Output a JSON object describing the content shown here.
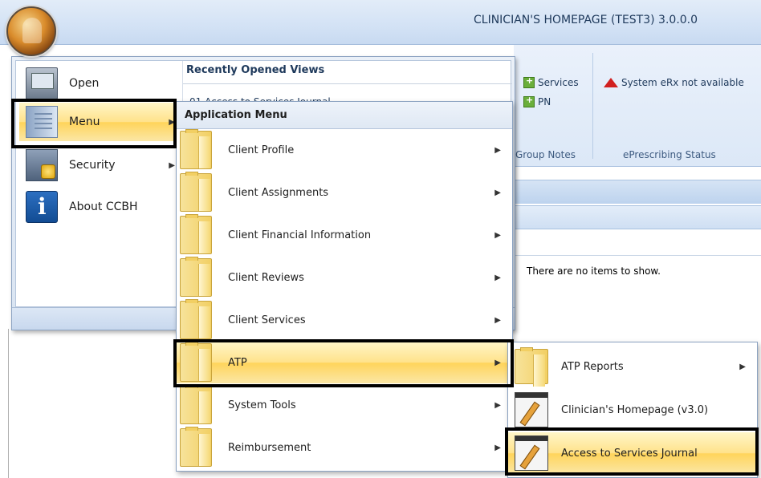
{
  "window": {
    "title": "CLINICIAN'S HOMEPAGE (TEST3) 3.0.0.0"
  },
  "ribbon": {
    "services_label": "Services",
    "pn_label": "PN",
    "erx_status": "System eRx not available",
    "group_notes_label": "Group Notes",
    "eprescribing_label": "ePrescribing Status"
  },
  "grid": {
    "empty_message": "There are no items to show."
  },
  "app_menu": {
    "items": [
      {
        "label": "Open",
        "icon": "open-icon",
        "has_submenu": false
      },
      {
        "label": "Menu",
        "icon": "menu-icon",
        "has_submenu": true,
        "selected": true
      },
      {
        "label": "Security",
        "icon": "security-icon",
        "has_submenu": true
      },
      {
        "label": "About CCBH",
        "icon": "about-icon",
        "has_submenu": false
      }
    ],
    "recent_header": "Recently Opened Views",
    "recent_items": [
      "01 Access to Services Journal"
    ]
  },
  "application_menu": {
    "header": "Application Menu",
    "items": [
      {
        "label": "Client Profile",
        "icon": "folder-icon",
        "has_submenu": true
      },
      {
        "label": "Client Assignments",
        "icon": "folder-icon",
        "has_submenu": true
      },
      {
        "label": "Client Financial Information",
        "icon": "folder-icon",
        "has_submenu": true
      },
      {
        "label": "Client Reviews",
        "icon": "folder-icon",
        "has_submenu": true
      },
      {
        "label": "Client Services",
        "icon": "folder-icon",
        "has_submenu": true
      },
      {
        "label": "ATP",
        "icon": "folder-icon",
        "has_submenu": true,
        "selected": true
      },
      {
        "label": "System Tools",
        "icon": "folder-icon",
        "has_submenu": true
      },
      {
        "label": "Reimbursement",
        "icon": "folder-icon",
        "has_submenu": true
      }
    ]
  },
  "atp_menu": {
    "items": [
      {
        "label": "ATP Reports",
        "icon": "folder-icon",
        "has_submenu": true
      },
      {
        "label": "Clinician's Homepage (v3.0)",
        "icon": "form-icon",
        "has_submenu": false
      },
      {
        "label": "Access to Services Journal",
        "icon": "form-icon",
        "has_submenu": false,
        "selected": true
      }
    ]
  },
  "colors": {
    "highlight": "#ffd45a",
    "frame": "#000000",
    "ribbon": "#dce8f7"
  }
}
